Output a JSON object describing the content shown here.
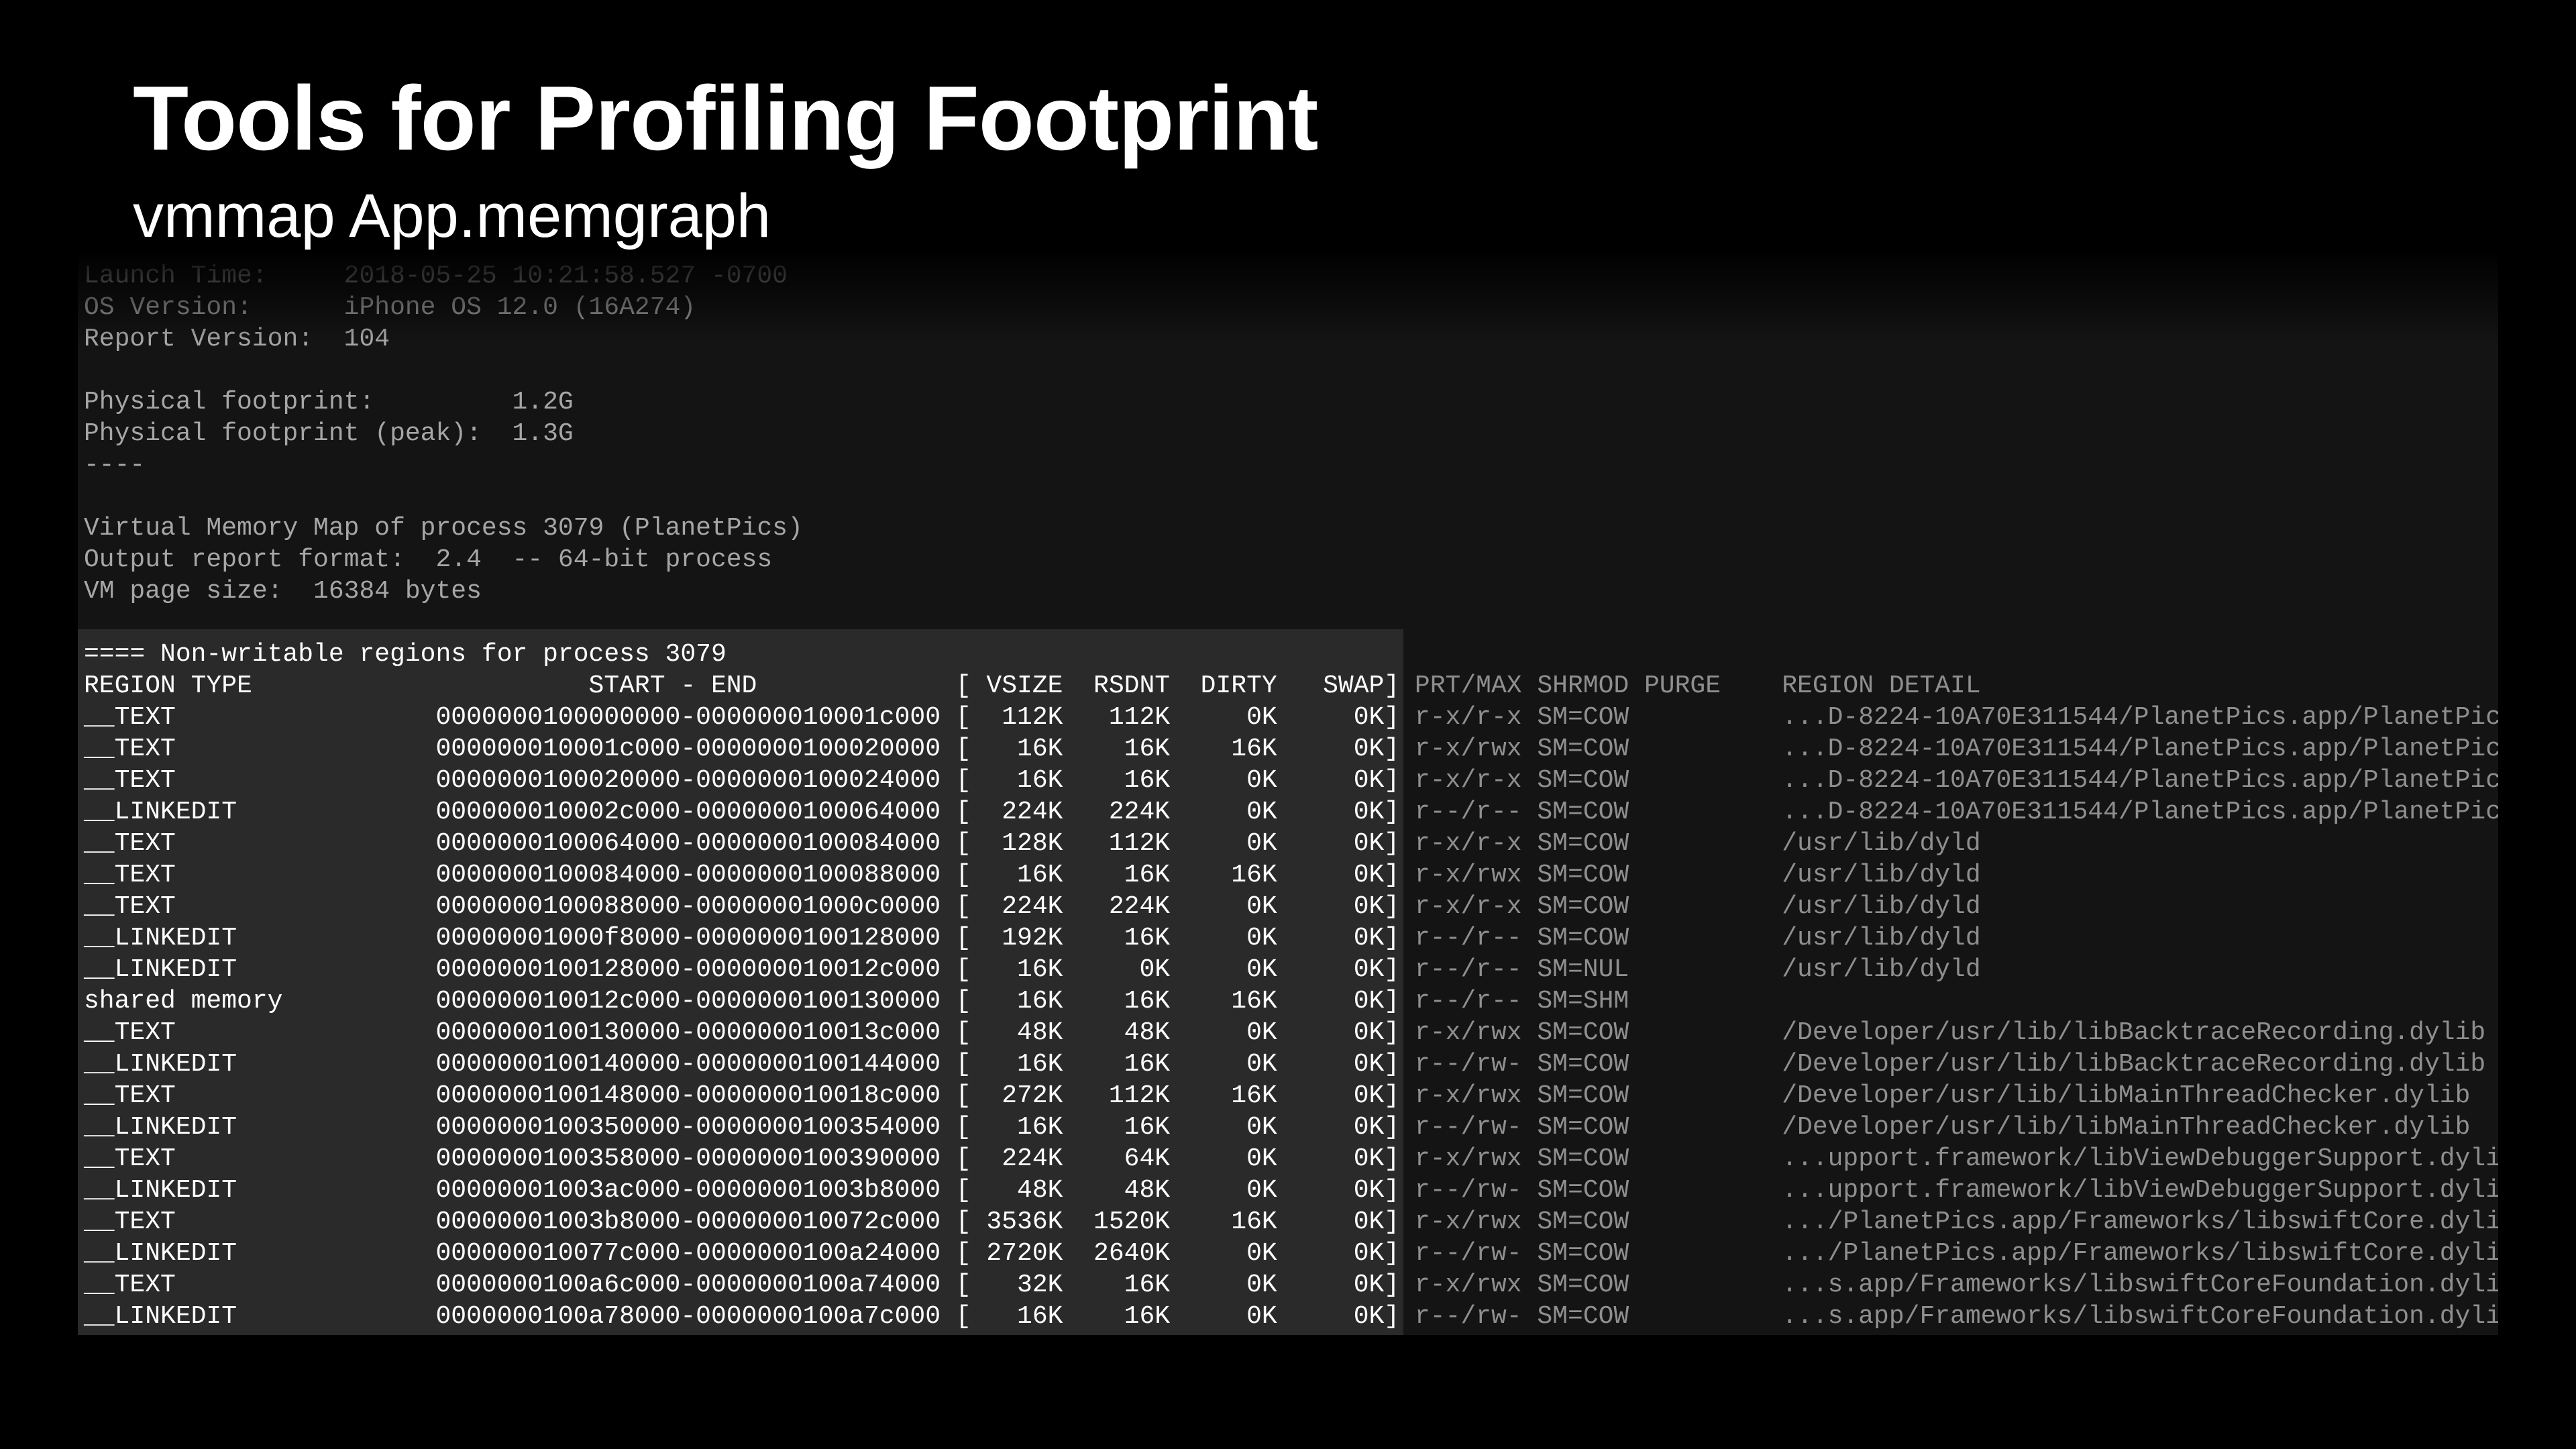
{
  "slide": {
    "title": "Tools for Profiling Footprint",
    "subtitle": "vmmap App.memgraph"
  },
  "terminal": {
    "preamble": [
      "Launch Time:     2018-05-25 10:21:58.527 -0700",
      "OS Version:      iPhone OS 12.0 (16A274)",
      "Report Version:  104",
      "",
      "Physical footprint:         1.2G",
      "Physical footprint (peak):  1.3G",
      "----",
      "",
      "Virtual Memory Map of process 3079 (PlanetPics)",
      "Output report format:  2.4  -- 64-bit process",
      "VM page size:  16384 bytes",
      ""
    ],
    "section_title": "==== Non-writable regions for process 3079",
    "table_header": {
      "left": "REGION TYPE                      START - END             [ VSIZE  RSDNT  DIRTY   SWAP]",
      "right": " PRT/MAX SHRMOD PURGE    REGION DETAIL"
    },
    "rows": [
      {
        "left": "__TEXT                 0000000100000000-000000010001c000 [  112K   112K     0K     0K]",
        "right": " r-x/r-x SM=COW          ...D-8224-10A70E311544/PlanetPics.app/PlanetPics"
      },
      {
        "left": "__TEXT                 000000010001c000-0000000100020000 [   16K    16K    16K     0K]",
        "right": " r-x/rwx SM=COW          ...D-8224-10A70E311544/PlanetPics.app/PlanetPics"
      },
      {
        "left": "__TEXT                 0000000100020000-0000000100024000 [   16K    16K     0K     0K]",
        "right": " r-x/r-x SM=COW          ...D-8224-10A70E311544/PlanetPics.app/PlanetPics"
      },
      {
        "left": "__LINKEDIT             000000010002c000-0000000100064000 [  224K   224K     0K     0K]",
        "right": " r--/r-- SM=COW          ...D-8224-10A70E311544/PlanetPics.app/PlanetPics"
      },
      {
        "left": "__TEXT                 0000000100064000-0000000100084000 [  128K   112K     0K     0K]",
        "right": " r-x/r-x SM=COW          /usr/lib/dyld"
      },
      {
        "left": "__TEXT                 0000000100084000-0000000100088000 [   16K    16K    16K     0K]",
        "right": " r-x/rwx SM=COW          /usr/lib/dyld"
      },
      {
        "left": "__TEXT                 0000000100088000-00000001000c0000 [  224K   224K     0K     0K]",
        "right": " r-x/r-x SM=COW          /usr/lib/dyld"
      },
      {
        "left": "__LINKEDIT             00000001000f8000-0000000100128000 [  192K    16K     0K     0K]",
        "right": " r--/r-- SM=COW          /usr/lib/dyld"
      },
      {
        "left": "__LINKEDIT             0000000100128000-000000010012c000 [   16K     0K     0K     0K]",
        "right": " r--/r-- SM=NUL          /usr/lib/dyld"
      },
      {
        "left": "shared memory          000000010012c000-0000000100130000 [   16K    16K    16K     0K]",
        "right": " r--/r-- SM=SHM"
      },
      {
        "left": "__TEXT                 0000000100130000-000000010013c000 [   48K    48K     0K     0K]",
        "right": " r-x/rwx SM=COW          /Developer/usr/lib/libBacktraceRecording.dylib"
      },
      {
        "left": "__LINKEDIT             0000000100140000-0000000100144000 [   16K    16K     0K     0K]",
        "right": " r--/rw- SM=COW          /Developer/usr/lib/libBacktraceRecording.dylib"
      },
      {
        "left": "__TEXT                 0000000100148000-000000010018c000 [  272K   112K    16K     0K]",
        "right": " r-x/rwx SM=COW          /Developer/usr/lib/libMainThreadChecker.dylib"
      },
      {
        "left": "__LINKEDIT             0000000100350000-0000000100354000 [   16K    16K     0K     0K]",
        "right": " r--/rw- SM=COW          /Developer/usr/lib/libMainThreadChecker.dylib"
      },
      {
        "left": "__TEXT                 0000000100358000-0000000100390000 [  224K    64K     0K     0K]",
        "right": " r-x/rwx SM=COW          ...upport.framework/libViewDebuggerSupport.dylib"
      },
      {
        "left": "__LINKEDIT             00000001003ac000-00000001003b8000 [   48K    48K     0K     0K]",
        "right": " r--/rw- SM=COW          ...upport.framework/libViewDebuggerSupport.dylib"
      },
      {
        "left": "__TEXT                 00000001003b8000-000000010072c000 [ 3536K  1520K    16K     0K]",
        "right": " r-x/rwx SM=COW          .../PlanetPics.app/Frameworks/libswiftCore.dylib"
      },
      {
        "left": "__LINKEDIT             000000010077c000-0000000100a24000 [ 2720K  2640K     0K     0K]",
        "right": " r--/rw- SM=COW          .../PlanetPics.app/Frameworks/libswiftCore.dylib"
      },
      {
        "left": "__TEXT                 0000000100a6c000-0000000100a74000 [   32K    16K     0K     0K]",
        "right": " r-x/rwx SM=COW          ...s.app/Frameworks/libswiftCoreFoundation.dylib"
      },
      {
        "left": "__LINKEDIT             0000000100a78000-0000000100a7c000 [   16K    16K     0K     0K]",
        "right": " r--/rw- SM=COW          ...s.app/Frameworks/libswiftCoreFoundation.dylib"
      }
    ]
  }
}
